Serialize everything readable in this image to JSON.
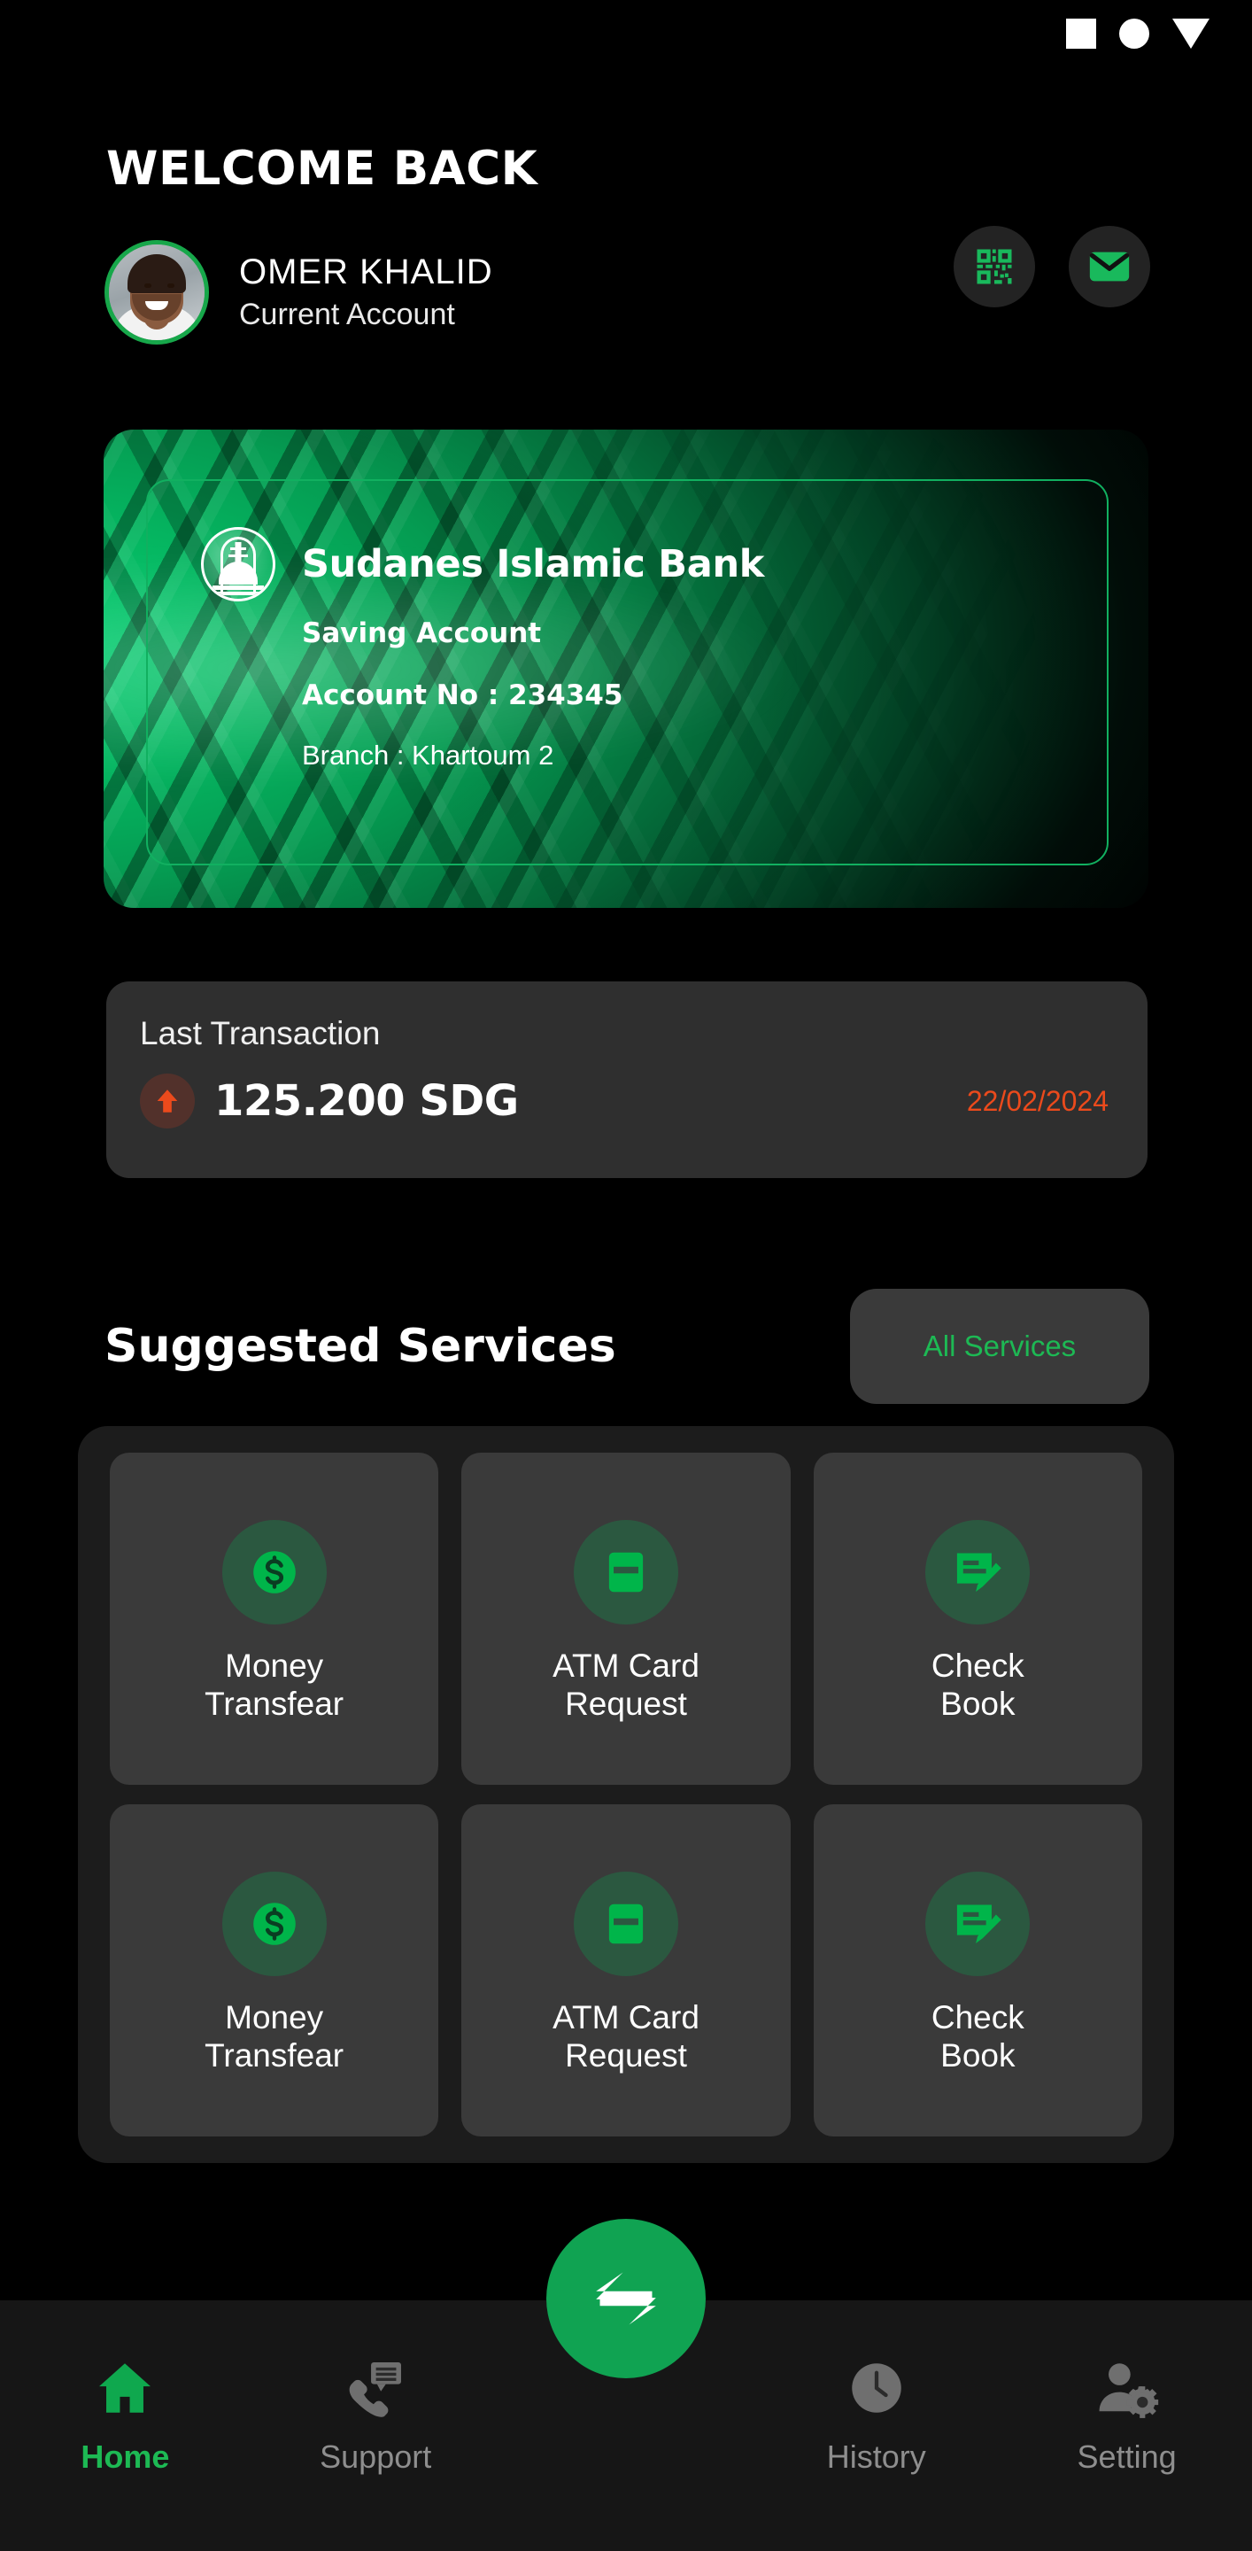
{
  "theme": {
    "background": "#000000",
    "accent_green": "#1db954",
    "card_green": "#00d070",
    "panel_dark": "#2f2f2f",
    "tile_dark": "#3a3a3a",
    "nav_bg": "#161616",
    "alert_red": "#eb4a1c",
    "inactive_gray": "#8e8e8e"
  },
  "status_bar": {
    "icons": [
      "square-icon",
      "circle-icon",
      "triangle-down-icon"
    ]
  },
  "header": {
    "welcome_title": "WELCOME BACK",
    "user_name": "OMER KHALID",
    "account_type": "Current Account",
    "avatar_alt": "user-avatar",
    "actions": [
      {
        "name": "qr-code-button",
        "icon": "qr-code-icon"
      },
      {
        "name": "mail-button",
        "icon": "envelope-icon"
      }
    ]
  },
  "bank_card": {
    "logo": "mosque-dome-icon",
    "bank_name": "Sudanes Islamic Bank",
    "account_type": "Saving Account",
    "account_no_label": "Account No : 234345",
    "branch_label": "Branch : Khartoum 2"
  },
  "last_transaction": {
    "title": "Last Transaction",
    "direction_icon": "arrow-up-icon",
    "amount": "125.200 SDG",
    "date": "22/02/2024"
  },
  "suggested_services": {
    "title": "Suggested Services",
    "all_services_label": "All Services",
    "rows": [
      [
        {
          "label": "Money\nTransfear",
          "icon": "dollar-circle-icon"
        },
        {
          "label": "ATM Card\nRequest",
          "icon": "credit-card-icon"
        },
        {
          "label": "Check\nBook",
          "icon": "check-edit-icon"
        }
      ],
      [
        {
          "label": "Money\nTransfear",
          "icon": "dollar-circle-icon"
        },
        {
          "label": "ATM Card\nRequest",
          "icon": "credit-card-icon"
        },
        {
          "label": "Check\nBook",
          "icon": "check-edit-icon"
        }
      ]
    ]
  },
  "bottom_nav": {
    "fab_icon": "transfer-arrows-icon",
    "items": [
      {
        "label": "Home",
        "icon": "home-icon",
        "active": true
      },
      {
        "label": "Support",
        "icon": "phone-chat-icon",
        "active": false
      },
      {
        "label": "History",
        "icon": "clock-icon",
        "active": false
      },
      {
        "label": "Setting",
        "icon": "user-gear-icon",
        "active": false
      }
    ]
  }
}
